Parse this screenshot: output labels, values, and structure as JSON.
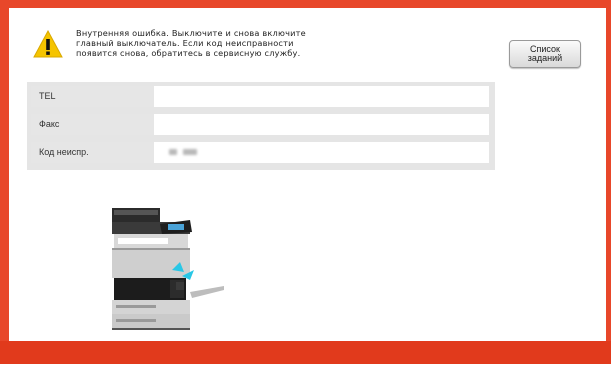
{
  "error": {
    "message_lines": [
      "Внутренняя ошибка. Выключите и снова включите",
      "главный выключатель. Если код неисправности",
      "появится снова, обратитесь в сервисную службу."
    ],
    "icon": "warning-icon",
    "accent_color": "#e8472a",
    "warning_color": "#f5c400"
  },
  "buttons": {
    "job_list_line1": "Список",
    "job_list_line2": "заданий"
  },
  "info": {
    "rows": [
      {
        "label": "TEL",
        "value": ""
      },
      {
        "label": "Факс",
        "value": ""
      },
      {
        "label": "Код неиспр.",
        "value": "(blurred)"
      }
    ]
  }
}
